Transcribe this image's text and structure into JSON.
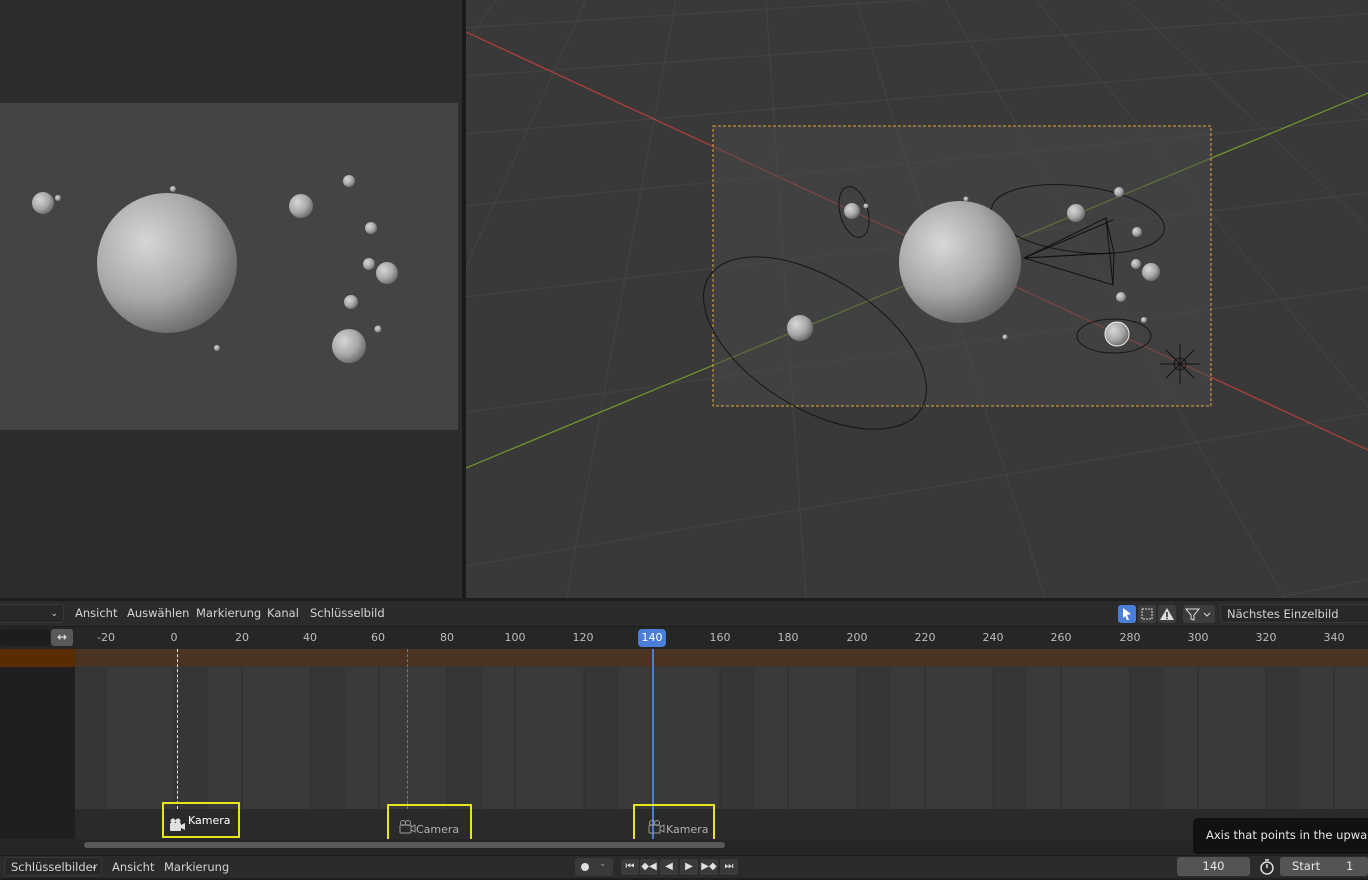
{
  "timeline_header": {
    "menus": [
      "Ansicht",
      "Auswählen",
      "Markierung",
      "Kanal",
      "Schlüsselbild"
    ],
    "snap_mode": "Nächstes Einzelbild"
  },
  "ruler": {
    "ticks": [
      "-20",
      "0",
      "20",
      "40",
      "60",
      "80",
      "100",
      "120",
      "140",
      "160",
      "180",
      "200",
      "220",
      "240",
      "260",
      "280",
      "300",
      "320",
      "340"
    ],
    "current_frame": "140"
  },
  "markers": [
    {
      "label": "Kamera",
      "frame": 0,
      "selected": true
    },
    {
      "label": "Camera",
      "frame": 68,
      "selected": false
    },
    {
      "label": "Kamera",
      "frame": 140,
      "selected": false
    }
  ],
  "tooltip": "Axis that points in the upward direction",
  "footer": {
    "mode": "Schlüsselbilder",
    "menus": [
      "Ansicht",
      "Markierung"
    ],
    "current_frame": "140",
    "start_label": "Start",
    "start_value": "1"
  },
  "colors": {
    "accent": "#4a7ed8",
    "marker_highlight": "#e6e61e",
    "camera_frame": "#e6a23c",
    "x_axis": "#b5403e",
    "y_axis": "#6f9a2c"
  }
}
